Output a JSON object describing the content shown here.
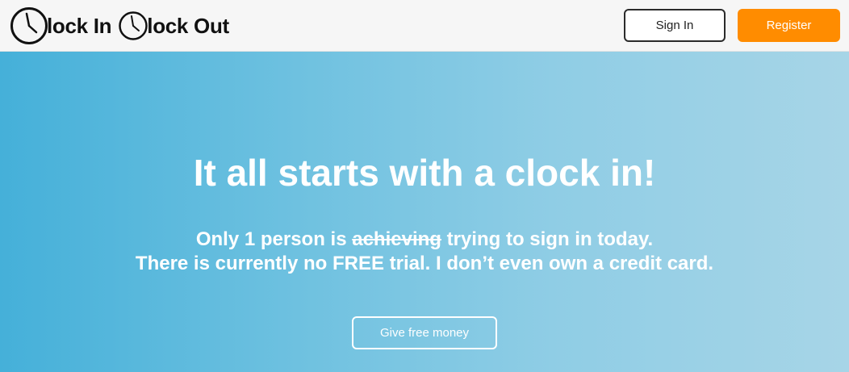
{
  "header": {
    "brand": {
      "clock_in_word": "lock In",
      "clock_out_word": "lock Out",
      "logo_icon": "clock-icon"
    },
    "sign_in_label": "Sign In",
    "register_label": "Register",
    "register_color": "#ff8c00"
  },
  "hero": {
    "title": "It all starts with a clock in!",
    "line1_prefix": "Only 1 person is ",
    "line1_struck": "achieving",
    "line1_suffix": " trying to sign in today.",
    "line2": "There is currently no FREE trial. I don’t even own a credit card.",
    "cta_label": "Give free money",
    "gradient_start": "#45b0d9",
    "gradient_end": "#a7d5e7"
  }
}
